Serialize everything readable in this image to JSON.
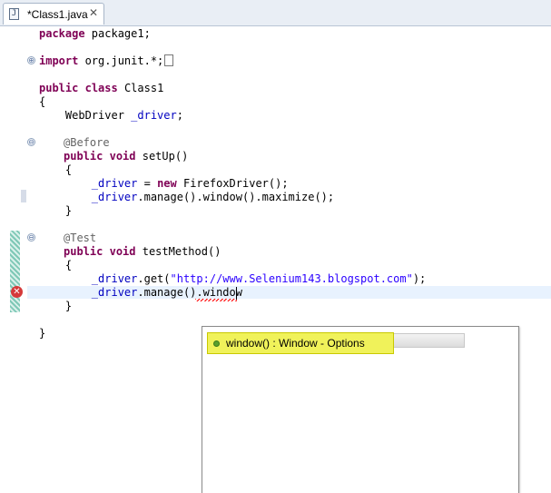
{
  "tab": {
    "title": "*Class1.java",
    "close_glyph": "✕",
    "icon_glyph": "J"
  },
  "code": {
    "l1": {
      "kw": "package",
      "rest": " package1;"
    },
    "l2": {
      "kw": "import",
      "rest": " org.junit.*;"
    },
    "l3": {
      "kw1": "public",
      "kw2": "class",
      "rest": " Class1"
    },
    "l4": "{",
    "l5": {
      "type": "    WebDriver ",
      "field": "_driver",
      "end": ";"
    },
    "l6": "@Before",
    "l7": {
      "kw1": "public",
      "kw2": "void",
      "rest": " setUp()"
    },
    "l8": "    {",
    "l9": {
      "indent": "        ",
      "field": "_driver",
      "mid": " = ",
      "kw": "new",
      "rest": " FirefoxDriver();"
    },
    "l10": {
      "indent": "        ",
      "field": "_driver",
      "rest": ".manage().window().maximize();"
    },
    "l11": "    }",
    "l12": "@Test",
    "l13": {
      "kw1": "public",
      "kw2": "void",
      "rest": " testMethod()"
    },
    "l14": "    {",
    "l15": {
      "indent": "        ",
      "field": "_driver",
      "pre": ".get(",
      "str": "\"http://www.Selenium143.blogspot.com\"",
      "end": ");"
    },
    "l16": {
      "indent": "        ",
      "field": "_driver",
      "rest": ".manage().window"
    },
    "l17": "    }",
    "l18": "}"
  },
  "gutter": {
    "fold_expanded": "⊖",
    "fold_collapsed": "⊕",
    "error_glyph": "✕"
  },
  "content_assist": {
    "item_label": "window() : Window - Options",
    "item_icon": "public-method-icon"
  },
  "colors": {
    "keyword": "#7f0055",
    "field": "#0000c0",
    "annotation": "#646464",
    "string": "#2a00ff",
    "selection": "#f0f25a"
  }
}
